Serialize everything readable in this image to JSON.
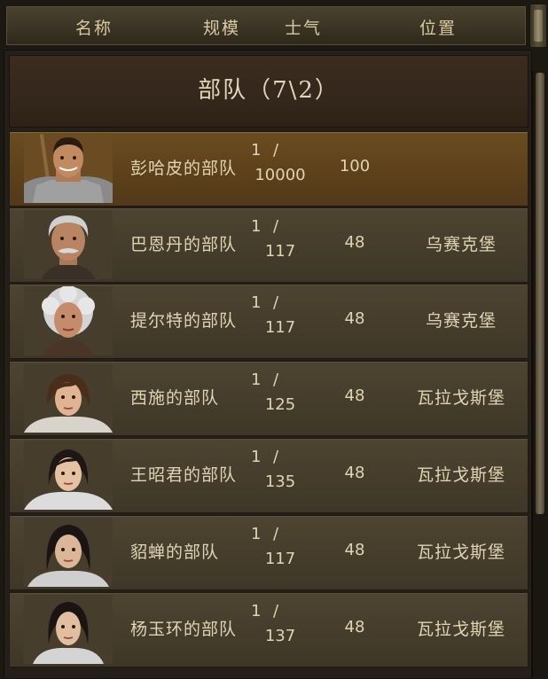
{
  "header": {
    "name_label": "名称",
    "size_label": "规模",
    "morale_label": "士气",
    "location_label": "位置"
  },
  "group": {
    "title": "部队（7\\2）"
  },
  "rows": [
    {
      "name": "彭哈皮的部队",
      "size_current": "1",
      "size_sep": "/",
      "size_max": "10000",
      "morale": "100",
      "location": "",
      "selected": true,
      "portrait": "male-warrior"
    },
    {
      "name": "巴恩丹的部队",
      "size_current": "1",
      "size_sep": "/",
      "size_max": "117",
      "morale": "48",
      "location": "乌赛克堡",
      "portrait": "old-man"
    },
    {
      "name": "提尔特的部队",
      "size_current": "1",
      "size_sep": "/",
      "size_max": "117",
      "morale": "48",
      "location": "乌赛克堡",
      "portrait": "old-woman"
    },
    {
      "name": "西施的部队",
      "size_current": "1",
      "size_sep": "/",
      "size_max": "125",
      "morale": "48",
      "location": "瓦拉戈斯堡",
      "portrait": "young-woman"
    },
    {
      "name": "王昭君的部队",
      "size_current": "1",
      "size_sep": "/",
      "size_max": "135",
      "morale": "48",
      "location": "瓦拉戈斯堡",
      "portrait": "young-woman"
    },
    {
      "name": "貂蝉的部队",
      "size_current": "1",
      "size_sep": "/",
      "size_max": "117",
      "morale": "48",
      "location": "瓦拉戈斯堡",
      "portrait": "young-woman"
    },
    {
      "name": "杨玉环的部队",
      "size_current": "1",
      "size_sep": "/",
      "size_max": "137",
      "morale": "48",
      "location": "瓦拉戈斯堡",
      "portrait": "young-woman"
    }
  ],
  "colors": {
    "selected_row": "#5e421b",
    "row": "#463d2c",
    "text": "#e0d4b4"
  }
}
